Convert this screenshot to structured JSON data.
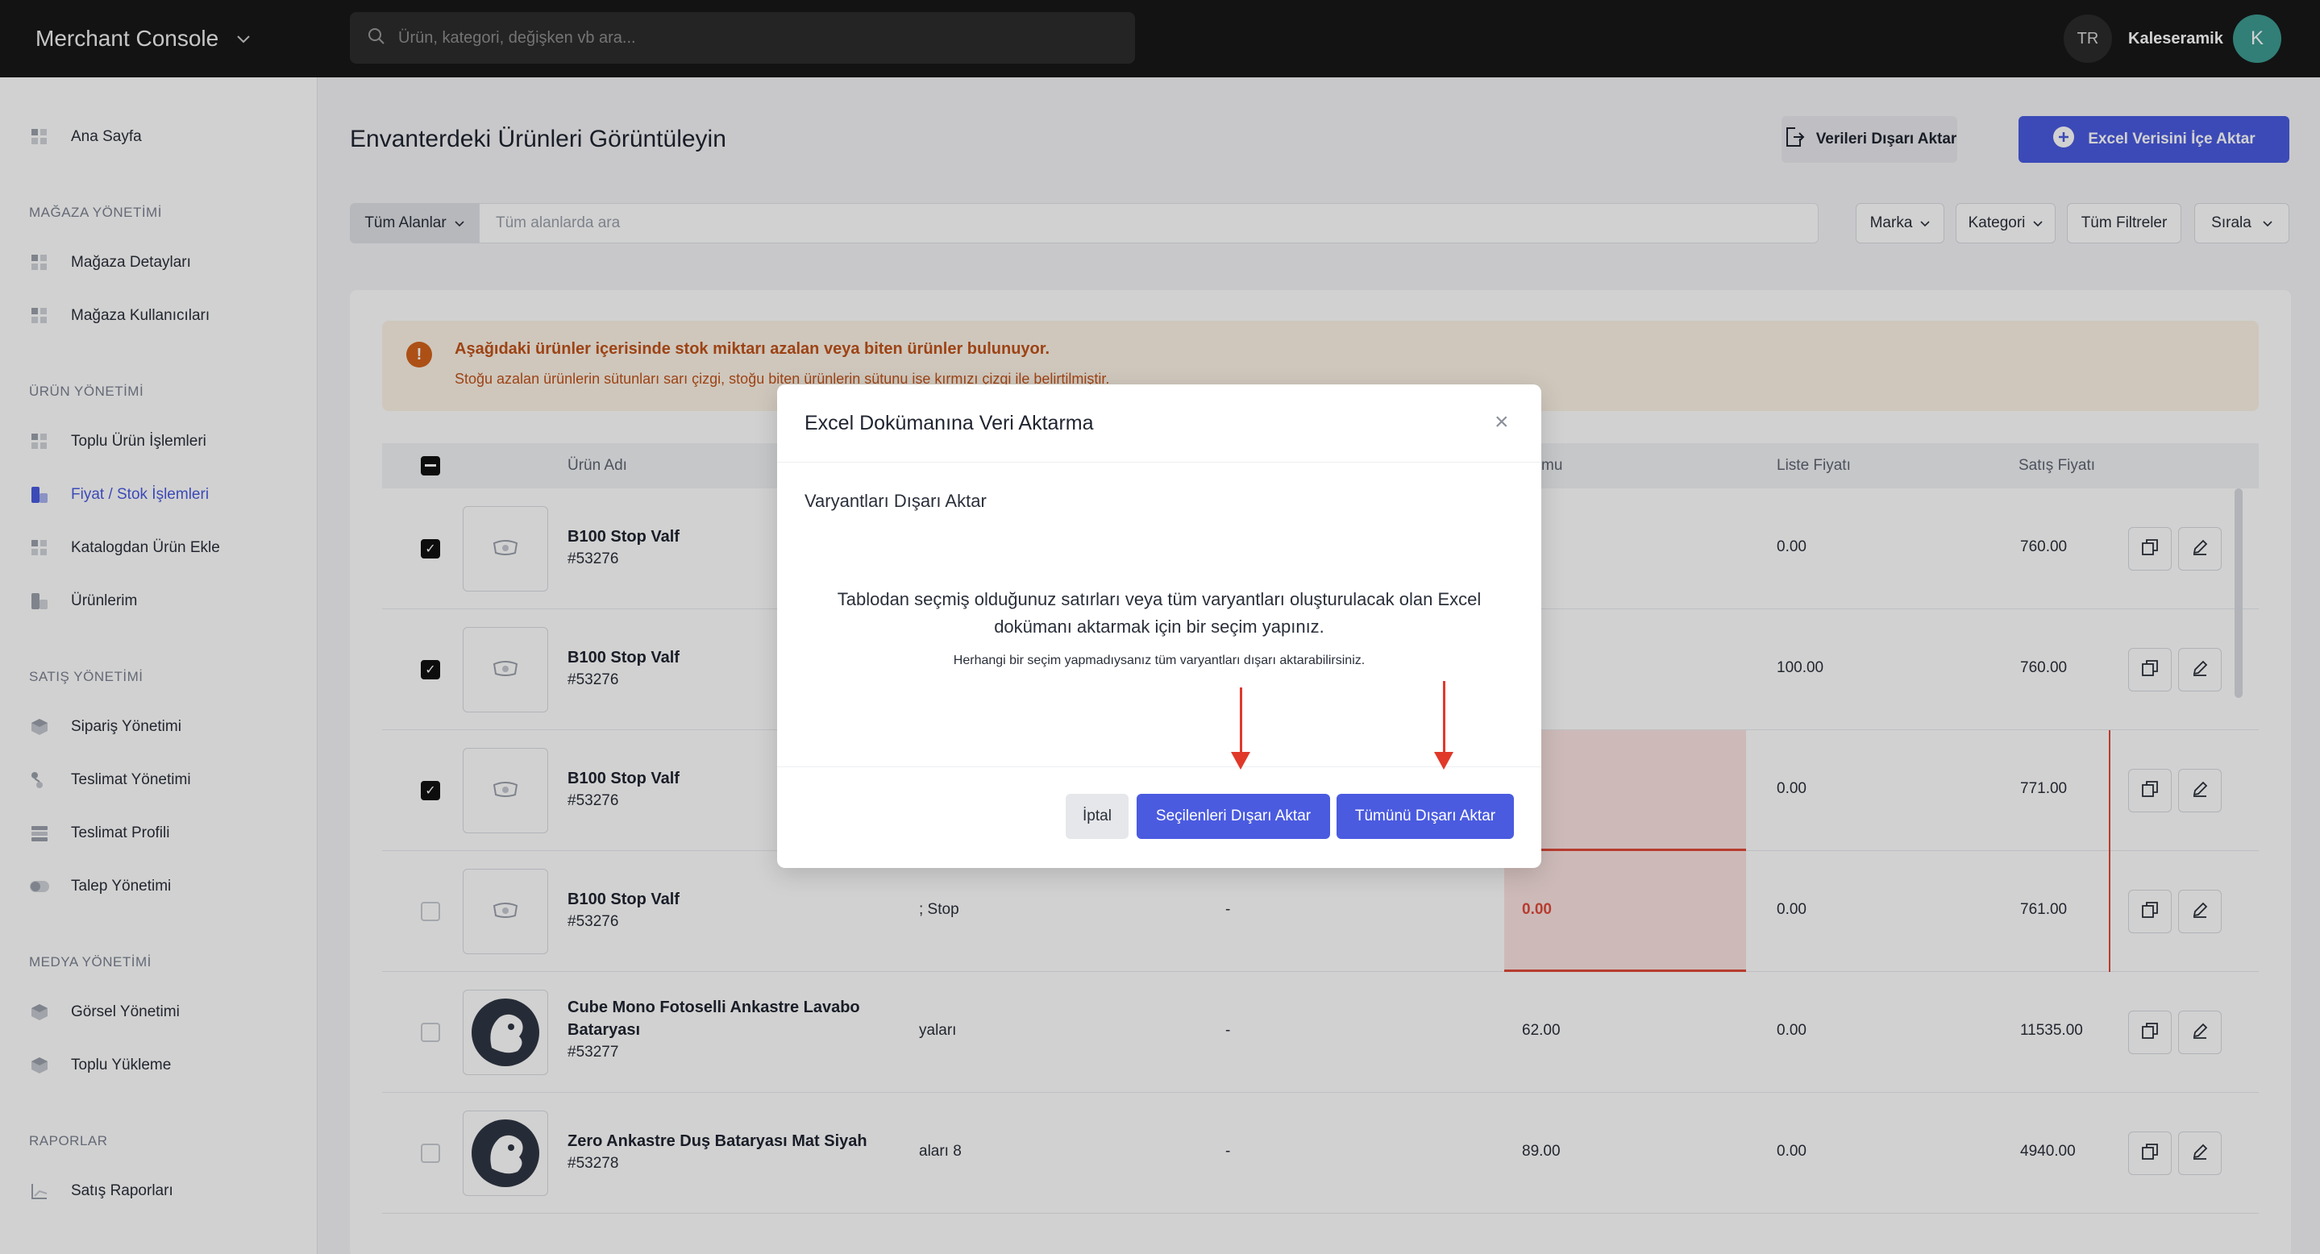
{
  "topbar": {
    "app_title": "Merchant Console",
    "search_placeholder": "Ürün, kategori, değişken vb ara...",
    "language": "TR",
    "store_name": "Kaleseramik",
    "avatar_initial": "K"
  },
  "sidebar": {
    "home": "Ana Sayfa",
    "sections": [
      {
        "title": "MAĞAZA YÖNETİMİ",
        "items": [
          "Mağaza Detayları",
          "Mağaza Kullanıcıları"
        ]
      },
      {
        "title": "ÜRÜN YÖNETİMİ",
        "items": [
          "Toplu Ürün İşlemleri",
          "Fiyat / Stok İşlemleri",
          "Katalogdan Ürün Ekle",
          "Ürünlerim"
        ]
      },
      {
        "title": "SATIŞ YÖNETİMİ",
        "items": [
          "Sipariş Yönetimi",
          "Teslimat Yönetimi",
          "Teslimat Profili",
          "Talep Yönetimi"
        ]
      },
      {
        "title": "MEDYA YÖNETİMİ",
        "items": [
          "Görsel Yönetimi",
          "Toplu Yükleme"
        ]
      },
      {
        "title": "RAPORLAR",
        "items": [
          "Satış Raporları"
        ]
      }
    ],
    "active_item": "Fiyat / Stok İşlemleri"
  },
  "main": {
    "title": "Envanterdeki Ürünleri Görüntüleyin",
    "export_button": "Verileri Dışarı Aktar",
    "import_button": "Excel Verisini İçe Aktar",
    "field_select": "Tüm Alanlar",
    "field_search_placeholder": "Tüm alanlarda ara",
    "filters": [
      "Marka",
      "Kategori",
      "Tüm Filtreler",
      "Sırala"
    ],
    "alert": {
      "title": "Aşağıdaki ürünler içerisinde stok miktarı azalan veya biten ürünler bulunuyor.",
      "body": "Stoğu azalan ürünlerin sütunları sarı çizgi, stoğu biten ürünlerin sütunu ise kırmızı çizgi ile belirtilmiştir."
    },
    "table": {
      "headers": {
        "name": "Ürün Adı",
        "stock": "mu",
        "list_price": "Liste Fiyatı",
        "sale_price": "Satış Fiyatı"
      },
      "rows": [
        {
          "name": "B100 Stop Valf",
          "sku": "#53276",
          "checked": true,
          "col_a": "",
          "col_b": "",
          "stock": "",
          "list_price": "0.00",
          "sale_price": "760.00"
        },
        {
          "name": "B100 Stop Valf",
          "sku": "#53276",
          "checked": true,
          "col_a": "",
          "col_b": "",
          "stock": "",
          "list_price": "100.00",
          "sale_price": "760.00"
        },
        {
          "name": "B100 Stop Valf",
          "sku": "#53276",
          "checked": true,
          "col_a": "",
          "col_b": "",
          "stock": "",
          "list_price": "0.00",
          "sale_price": "771.00"
        },
        {
          "name": "B100 Stop Valf",
          "sku": "#53276",
          "checked": false,
          "col_a": "; Stop",
          "col_b": "-",
          "stock": "0.00",
          "list_price": "0.00",
          "sale_price": "761.00"
        },
        {
          "name": "Cube Mono Fotoselli Ankastre Lavabo Bataryası",
          "sku": "#53277",
          "checked": false,
          "col_a": "yaları",
          "col_b": "-",
          "stock": "62.00",
          "list_price": "0.00",
          "sale_price": "11535.00"
        },
        {
          "name": "Zero Ankastre Duş Bataryası Mat Siyah",
          "sku": "#53278",
          "checked": false,
          "col_a": "aları 8",
          "col_b": "-",
          "stock": "89.00",
          "list_price": "0.00",
          "sale_price": "4940.00"
        }
      ]
    }
  },
  "modal": {
    "title": "Excel Dokümanına Veri Aktarma",
    "subtitle": "Varyantları Dışarı Aktar",
    "message": "Tablodan seçmiş olduğunuz satırları veya tüm varyantları oluşturulacak olan Excel dokümanı aktarmak için bir seçim yapınız.",
    "note": "Herhangi bir seçim yapmadıysanız tüm varyantları dışarı aktarabilirsiniz.",
    "cancel": "İptal",
    "export_selected": "Seçilenleri Dışarı Aktar",
    "export_all": "Tümünü Dışarı Aktar"
  },
  "colors": {
    "accent": "#4a5be0",
    "topbar": "#181818",
    "alert_text": "#c0521a",
    "arrow": "#e0392a",
    "stock_out": "#e04a3a"
  }
}
